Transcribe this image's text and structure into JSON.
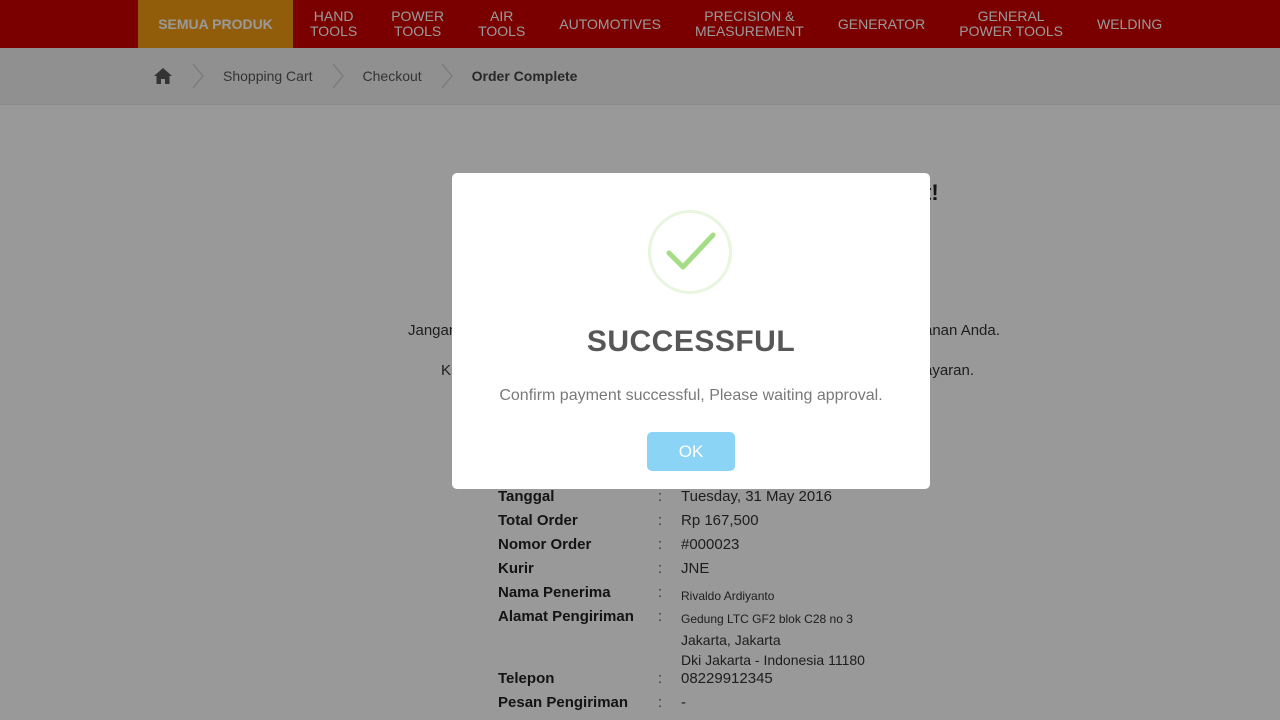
{
  "nav": {
    "items": [
      {
        "label": "SEMUA PRODUK"
      },
      {
        "label": "HAND\nTOOLS"
      },
      {
        "label": "POWER\nTOOLS"
      },
      {
        "label": "AIR\nTOOLS"
      },
      {
        "label": "AUTOMOTIVES"
      },
      {
        "label": "PRECISION &\nMEASUREMENT"
      },
      {
        "label": "GENERATOR"
      },
      {
        "label": "GENERAL\nPOWER TOOLS"
      },
      {
        "label": "WELDING"
      }
    ]
  },
  "breadcrumb": {
    "home_icon": "home-icon",
    "items": [
      "Shopping Cart",
      "Checkout",
      "Order Complete"
    ]
  },
  "page": {
    "heading_fragment": "t!",
    "line1_start": "Jangan",
    "line1_end": "anan Anda.",
    "line2_start": "K",
    "line2_end": "ayaran."
  },
  "order": {
    "rows": [
      {
        "key": "Tanggal",
        "value": "Tuesday, 31 May 2016"
      },
      {
        "key": "Total Order",
        "value": "Rp 167,500"
      },
      {
        "key": "Nomor Order",
        "value": "#000023"
      },
      {
        "key": "Kurir",
        "value": "JNE"
      },
      {
        "key": "Nama Penerima",
        "value": "Rivaldo Ardiyanto"
      },
      {
        "key": "Alamat Pengiriman",
        "value": "Gedung LTC GF2 blok C28 no 3",
        "value2": "Jakarta, Jakarta",
        "value3": "Dki Jakarta - Indonesia 11180"
      },
      {
        "key": "Telepon",
        "value": "08229912345"
      },
      {
        "key": "Pesan Pengiriman",
        "value": "-"
      }
    ],
    "separator": ":"
  },
  "modal": {
    "icon": "success-check-icon",
    "title": "SUCCESSFUL",
    "text": "Confirm payment successful, Please waiting approval.",
    "ok_label": "OK"
  },
  "colors": {
    "nav_bg": "#cc0000",
    "nav_active": "#f39c12",
    "ok_button": "#8cd4f5",
    "check": "#a5dc86"
  }
}
